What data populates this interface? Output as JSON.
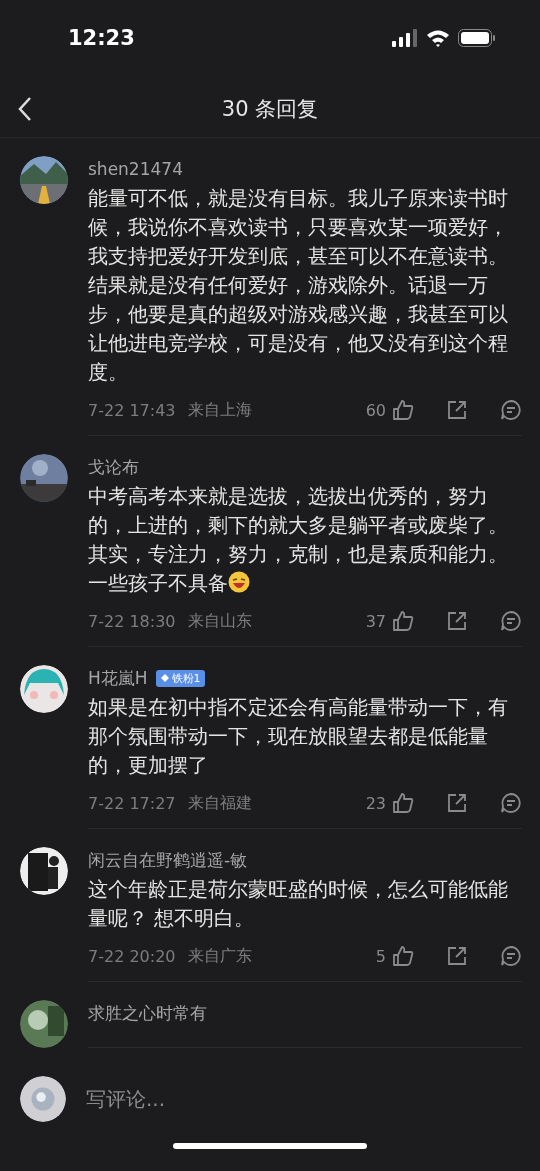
{
  "status_bar": {
    "time": "12:23"
  },
  "header": {
    "title": "30 条回复"
  },
  "comments": [
    {
      "name": "shen21474",
      "text": "能量可不低，就是没有目标。我儿子原来读书时候，我说你不喜欢读书，只要喜欢某一项爱好，我支持把爱好开发到底，甚至可以不在意读书。结果就是没有任何爱好，游戏除外。话退一万步，他要是真的超级对游戏感兴趣，我甚至可以让他进电竞学校，可是没有，他又没有到这个程度。",
      "emoji": false,
      "time": "7-22 17:43",
      "location": "来自上海",
      "likes": "60"
    },
    {
      "name": "戈论布",
      "text": "中考高考本来就是选拔，选拔出优秀的，努力的，上进的，剩下的就大多是躺平者或废柴了。其实，专注力，努力，克制，也是素质和能力。一些孩子不具备",
      "emoji": true,
      "time": "7-22 18:30",
      "location": "来自山东",
      "likes": "37"
    },
    {
      "name": "H花嵐H",
      "badge": "铁粉1",
      "text": "如果是在初中指不定还会有高能量带动一下，有那个氛围带动一下，现在放眼望去都是低能量的，更加摆了",
      "emoji": false,
      "time": "7-22 17:27",
      "location": "来自福建",
      "likes": "23"
    },
    {
      "name": "闲云自在野鹤逍遥-敏",
      "text": "这个年龄正是荷尔蒙旺盛的时候，怎么可能低能量呢？ 想不明白。",
      "emoji": false,
      "time": "7-22 20:20",
      "location": "来自广东",
      "likes": "5"
    },
    {
      "name": "求胜之心时常有"
    }
  ],
  "composer": {
    "placeholder": "写评论..."
  }
}
